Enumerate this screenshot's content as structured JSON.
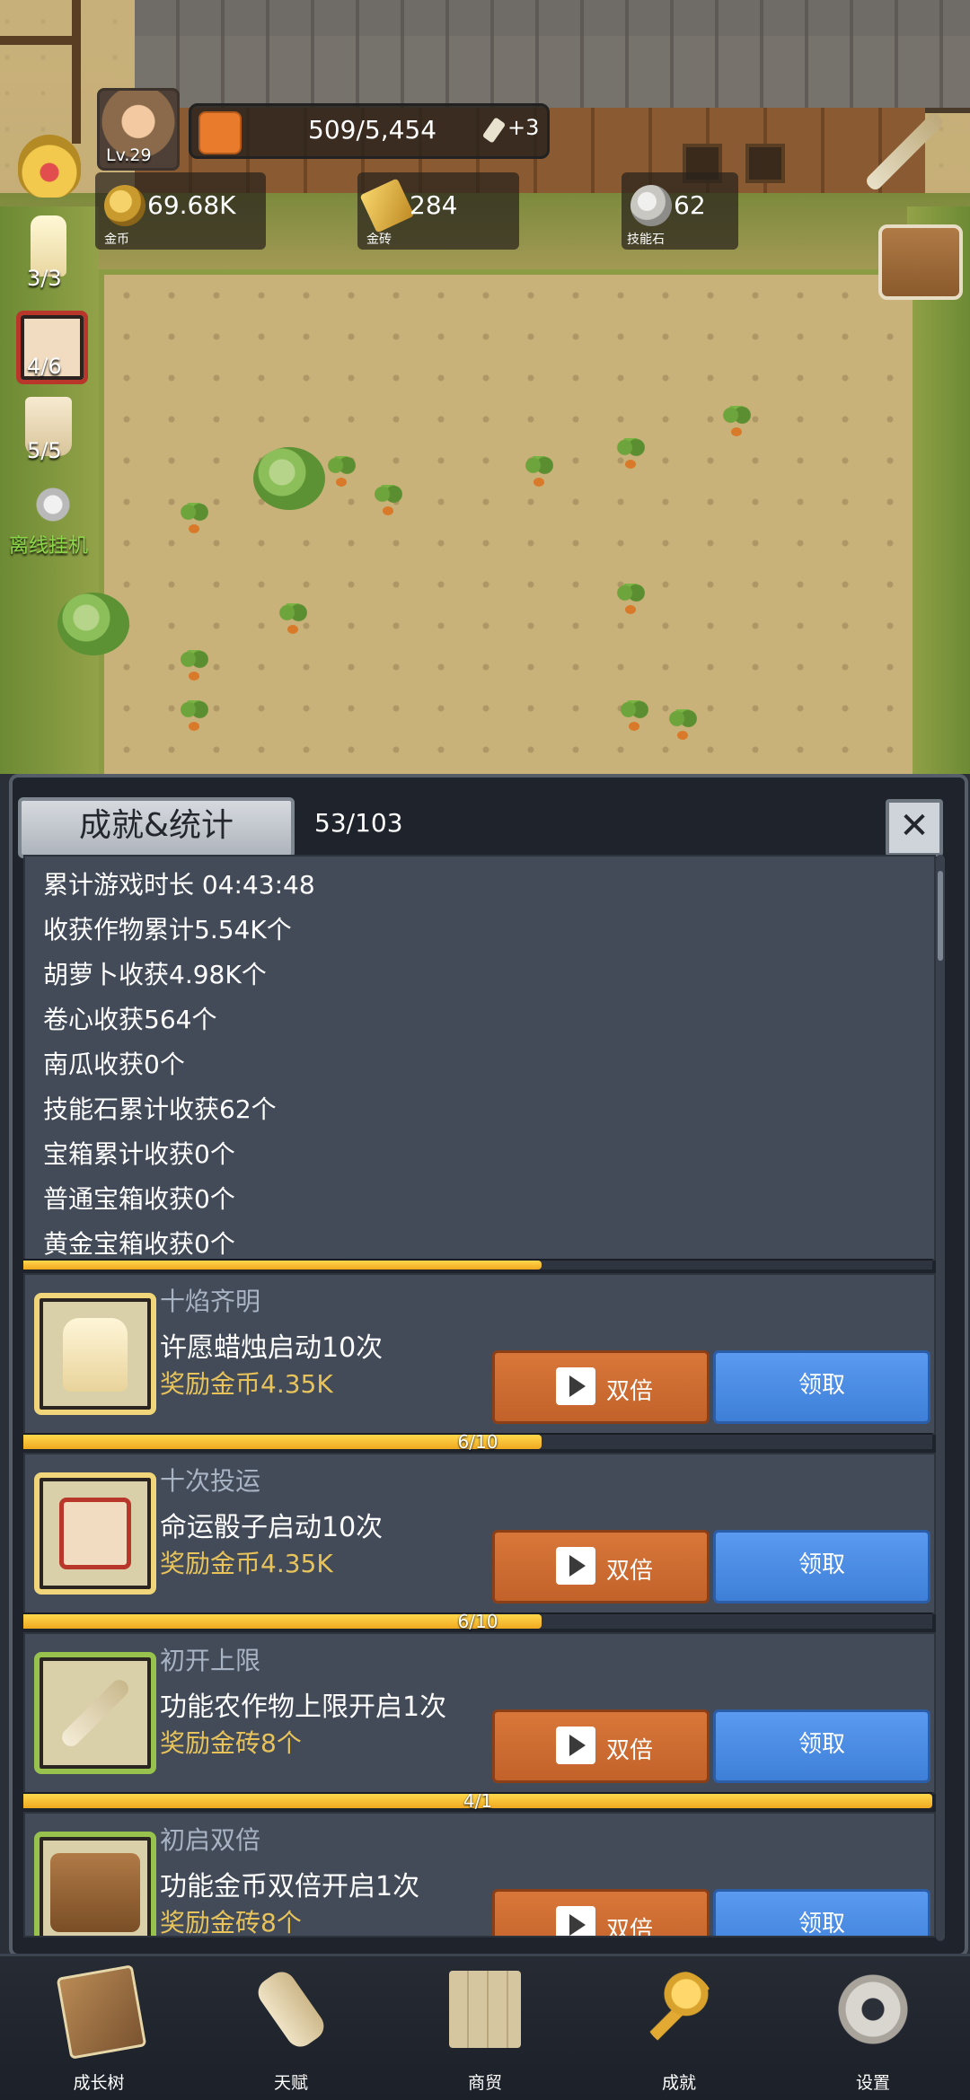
{
  "hud": {
    "level": "Lv.29",
    "energy": "509/5,454",
    "energy_bonus": "+3",
    "resources": [
      {
        "icon": "coin-icon",
        "value": "69.68K",
        "label": "金币"
      },
      {
        "icon": "gold-brick-icon",
        "value": "284",
        "label": "金砖"
      },
      {
        "icon": "skill-stone-icon",
        "value": "62",
        "label": "技能石"
      }
    ]
  },
  "sidebar": {
    "candle_count": "3/3",
    "dice_count": "4/6",
    "cup_count": "5/5",
    "idle_label": "离线挂机"
  },
  "panel": {
    "title": "成就&统计",
    "progress": "53/103",
    "close_label": "✕"
  },
  "stats": [
    "累计游戏时长 04:43:48",
    "收获作物累计5.54K个",
    "胡萝卜收获4.98K个",
    "卷心收获564个",
    "南瓜收获0个",
    "技能石累计收获62个",
    "宝箱累计收获0个",
    "普通宝箱收获0个",
    "黄金宝箱收获0个"
  ],
  "achievements": [
    {
      "title": "十焰齐明",
      "desc": "许愿蜡烛启动10次",
      "reward": "奖励金币4.35K",
      "double_label": "双倍",
      "claim_label": "领取",
      "icon": "candle-icon",
      "progress_text": "6/10",
      "progress": 0.57
    },
    {
      "title": "十次投运",
      "desc": "命运骰子启动10次",
      "reward": "奖励金币4.35K",
      "double_label": "双倍",
      "claim_label": "领取",
      "icon": "dice-icon",
      "progress_text": "6/10",
      "progress": 0.57
    },
    {
      "title": "初开上限",
      "desc": "功能农作物上限开启1次",
      "reward": "奖励金砖8个",
      "double_label": "双倍",
      "claim_label": "领取",
      "icon": "broom-icon",
      "progress_text": "4/1",
      "progress": 1.0
    },
    {
      "title": "初启双倍",
      "desc": "功能金币双倍开启1次",
      "reward": "奖励金砖8个",
      "double_label": "双倍",
      "claim_label": "领取",
      "icon": "treasure-chest-icon"
    }
  ],
  "top_bar_partial": {
    "progress": 0.57
  },
  "nav": [
    {
      "label": "成长树",
      "icon": "book-icon"
    },
    {
      "label": "天赋",
      "icon": "scroll-icon"
    },
    {
      "label": "商贸",
      "icon": "map-icon"
    },
    {
      "label": "成就",
      "icon": "golden-key-icon"
    },
    {
      "label": "设置",
      "icon": "gear-icon"
    }
  ],
  "colors": {
    "accent_orange": "#c2622a",
    "accent_blue": "#3e7fd8",
    "reward_gold": "#e8c35a",
    "progress_yellow": "#f0a820"
  }
}
